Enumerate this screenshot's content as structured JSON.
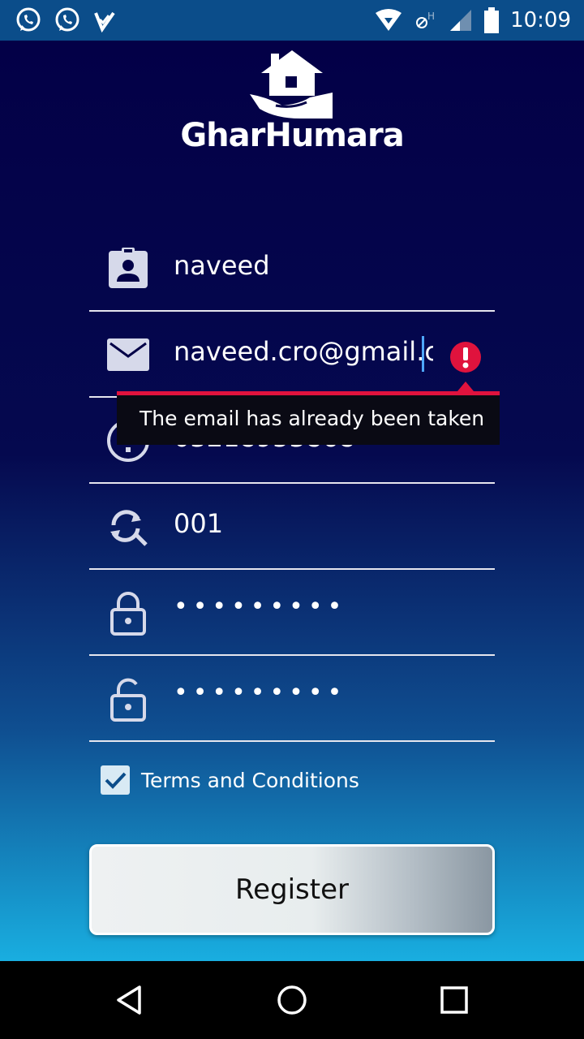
{
  "status_bar": {
    "time": "10:09",
    "left_icons": [
      "whatsapp-icon",
      "whatsapp-icon",
      "check-app-icon"
    ],
    "right_icons": [
      "wifi-icon",
      "no-data-icon",
      "signal-icon",
      "battery-icon"
    ]
  },
  "brand": {
    "name": "GharHumara"
  },
  "form": {
    "name": {
      "value": "naveed",
      "icon": "contact-card-icon"
    },
    "email": {
      "value": "naveed.cro@gmail.c",
      "icon": "mail-icon",
      "error": "The email has already been taken"
    },
    "phone": {
      "value": "03218953868",
      "icon": "alert-circle-icon"
    },
    "code": {
      "value": "001",
      "icon": "search-refresh-icon"
    },
    "password": {
      "value": "•••••••••",
      "icon": "lock-icon"
    },
    "confirm_password": {
      "value": "•••••••••",
      "icon": "unlock-icon"
    },
    "terms": {
      "label": "Terms and Conditions",
      "checked": true
    },
    "register_label": "Register"
  },
  "colors": {
    "error": "#e0133d",
    "accent": "#4ea7ff",
    "bg_top": "#030047",
    "bg_bottom": "#19aee0"
  }
}
